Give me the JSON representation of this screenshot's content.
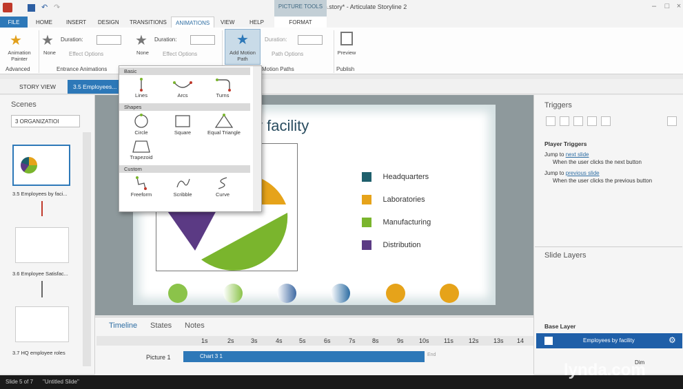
{
  "window": {
    "title": "KE_NHOrientation.story* - Articulate Storyline 2",
    "picture_tools": "PICTURE TOOLS"
  },
  "ribbon_tabs": [
    "FILE",
    "HOME",
    "INSERT",
    "DESIGN",
    "TRANSITIONS",
    "ANIMATIONS",
    "VIEW",
    "HELP",
    "FORMAT"
  ],
  "ribbon": {
    "animation_painter": "Animation Painter",
    "advanced_group": "Advanced",
    "entrance": {
      "effect": "None",
      "duration_label": "Duration:",
      "effect_options": "Effect Options",
      "group": "Entrance Animations"
    },
    "exit": {
      "effect": "None",
      "duration_label": "Duration:",
      "effect_options": "Effect Options"
    },
    "motion": {
      "add_label": "Add Motion Path",
      "duration_label": "Duration:",
      "path_options": "Path Options",
      "group": "Motion Paths"
    },
    "preview": {
      "label": "Preview",
      "group": "Publish"
    }
  },
  "view_tabs": [
    "STORY VIEW",
    "3.5 Employees..."
  ],
  "scenes": {
    "title": "Scenes",
    "dropdown": "3 ORGANIZATIOI",
    "thumbs": [
      "3.5 Employees by faci...",
      "3.6 Employee Satisfac...",
      "3.7 HQ employee roles"
    ]
  },
  "motion_menu": {
    "sections": [
      {
        "name": "Basic",
        "items": [
          "Lines",
          "Arcs",
          "Turns"
        ]
      },
      {
        "name": "Shapes",
        "items": [
          "Circle",
          "Square",
          "Equal Triangle",
          "Trapezoid"
        ]
      },
      {
        "name": "Custom",
        "items": [
          "Freeform",
          "Scribble",
          "Curve"
        ]
      }
    ]
  },
  "slide": {
    "title_fragment": "y facility",
    "legend": [
      {
        "label": "Headquarters",
        "color": "#1e5f6c"
      },
      {
        "label": "Laboratories",
        "color": "#e6a31a"
      },
      {
        "label": "Manufacturing",
        "color": "#7ab52d"
      },
      {
        "label": "Distribution",
        "color": "#5b3a84"
      }
    ]
  },
  "timeline": {
    "tabs": [
      "Timeline",
      "States",
      "Notes"
    ],
    "ticks": [
      "1s",
      "2s",
      "3s",
      "4s",
      "5s",
      "6s",
      "7s",
      "8s",
      "9s",
      "10s",
      "11s",
      "12s",
      "13s",
      "14"
    ],
    "rows": [
      {
        "name": "Picture 1",
        "bar": "Chart 3 1"
      }
    ],
    "end_label": "End"
  },
  "triggers": {
    "title": "Triggers",
    "section": "Player Triggers",
    "items": [
      {
        "prefix": "Jump to ",
        "link": "next slide",
        "when": "When the user clicks the next button"
      },
      {
        "prefix": "Jump to ",
        "link": "previous slide",
        "when": "When the user clicks the previous button"
      }
    ]
  },
  "layers": {
    "title": "Slide Layers",
    "base": "Base Layer",
    "layer_name": "Employees by facility",
    "dim": "Dim"
  },
  "status": {
    "slide": "Slide 5 of 7",
    "name": "\"Untitled Slide\""
  },
  "watermark": "lynda.com"
}
